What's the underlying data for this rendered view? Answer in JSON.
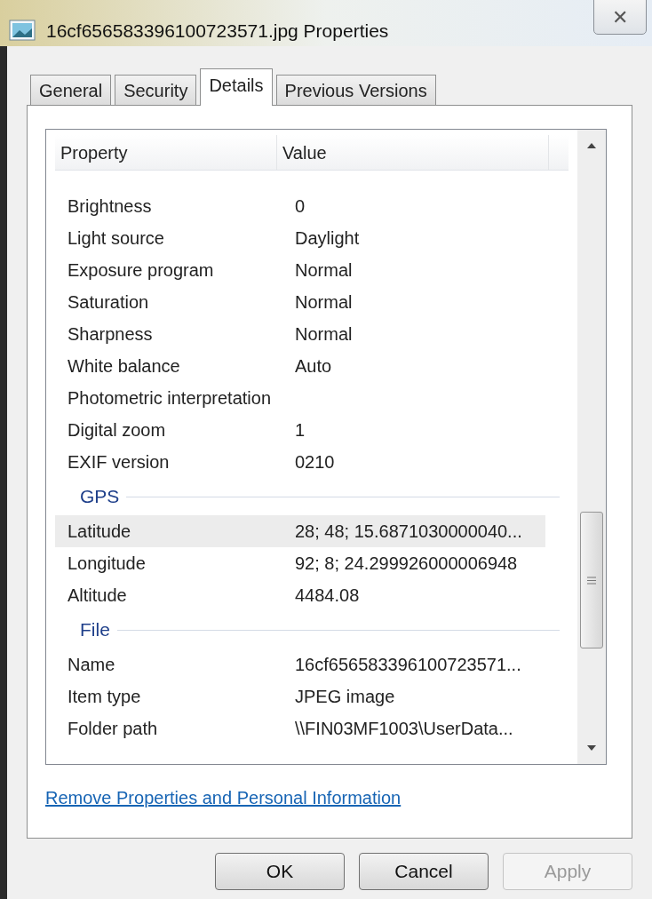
{
  "window": {
    "title": "16cf656583396100723571.jpg Properties",
    "close": "✕"
  },
  "tabs": [
    {
      "label": "General",
      "selected": false
    },
    {
      "label": "Security",
      "selected": false
    },
    {
      "label": "Details",
      "selected": true
    },
    {
      "label": "Previous Versions",
      "selected": false
    }
  ],
  "table": {
    "columns": [
      "Property",
      "Value"
    ],
    "rows": [
      {
        "kind": "row",
        "property": "Brightness",
        "value": "0",
        "selected": false
      },
      {
        "kind": "row",
        "property": "Light source",
        "value": "Daylight",
        "selected": false
      },
      {
        "kind": "row",
        "property": "Exposure program",
        "value": "Normal",
        "selected": false
      },
      {
        "kind": "row",
        "property": "Saturation",
        "value": "Normal",
        "selected": false
      },
      {
        "kind": "row",
        "property": "Sharpness",
        "value": "Normal",
        "selected": false
      },
      {
        "kind": "row",
        "property": "White balance",
        "value": "Auto",
        "selected": false
      },
      {
        "kind": "row",
        "property": "Photometric interpretation",
        "value": "",
        "selected": false
      },
      {
        "kind": "row",
        "property": "Digital zoom",
        "value": "1",
        "selected": false
      },
      {
        "kind": "row",
        "property": "EXIF version",
        "value": "0210",
        "selected": false
      },
      {
        "kind": "group",
        "label": "GPS"
      },
      {
        "kind": "row",
        "property": "Latitude",
        "value": "28; 48; 15.6871030000040...",
        "selected": true
      },
      {
        "kind": "row",
        "property": "Longitude",
        "value": "92; 8; 24.299926000006948",
        "selected": false
      },
      {
        "kind": "row",
        "property": "Altitude",
        "value": "4484.08",
        "selected": false
      },
      {
        "kind": "group",
        "label": "File"
      },
      {
        "kind": "row",
        "property": "Name",
        "value": "16cf656583396100723571...",
        "selected": false
      },
      {
        "kind": "row",
        "property": "Item type",
        "value": "JPEG image",
        "selected": false
      },
      {
        "kind": "row",
        "property": "Folder path",
        "value": "\\\\FIN03MF1003\\UserData...",
        "selected": false
      }
    ]
  },
  "link": "Remove Properties and Personal Information",
  "buttons": [
    {
      "label": "OK",
      "disabled": false
    },
    {
      "label": "Cancel",
      "disabled": false
    },
    {
      "label": "Apply",
      "disabled": true
    }
  ]
}
